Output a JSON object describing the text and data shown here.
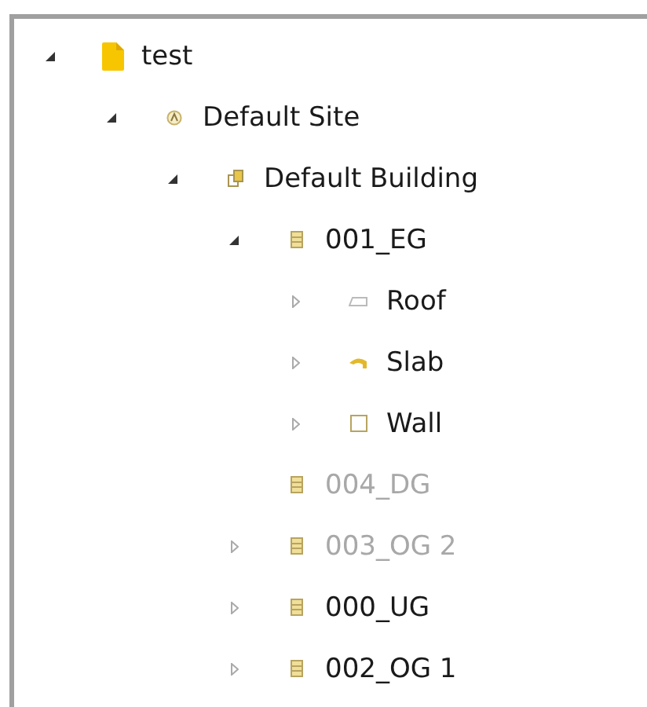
{
  "tree": [
    {
      "label": "test",
      "kind": "project",
      "expanded": true,
      "disabled": false,
      "children": [
        {
          "label": "Default Site",
          "kind": "site",
          "expanded": true,
          "disabled": false,
          "children": [
            {
              "label": "Default Building",
              "kind": "building",
              "expanded": true,
              "disabled": false,
              "children": [
                {
                  "label": "001_EG",
                  "kind": "storey",
                  "expanded": true,
                  "disabled": false,
                  "children": [
                    {
                      "label": "Roof",
                      "kind": "roof",
                      "expanded": false,
                      "disabled": false
                    },
                    {
                      "label": "Slab",
                      "kind": "slab",
                      "expanded": false,
                      "disabled": false
                    },
                    {
                      "label": "Wall",
                      "kind": "wall",
                      "expanded": false,
                      "disabled": false
                    }
                  ]
                },
                {
                  "label": "004_DG",
                  "kind": "storey",
                  "disabled": true
                },
                {
                  "label": "003_OG 2",
                  "kind": "storey",
                  "expanded": false,
                  "disabled": true
                },
                {
                  "label": "000_UG",
                  "kind": "storey",
                  "expanded": false,
                  "disabled": false
                },
                {
                  "label": "002_OG 1",
                  "kind": "storey",
                  "expanded": false,
                  "disabled": false
                }
              ]
            }
          ]
        }
      ]
    }
  ]
}
